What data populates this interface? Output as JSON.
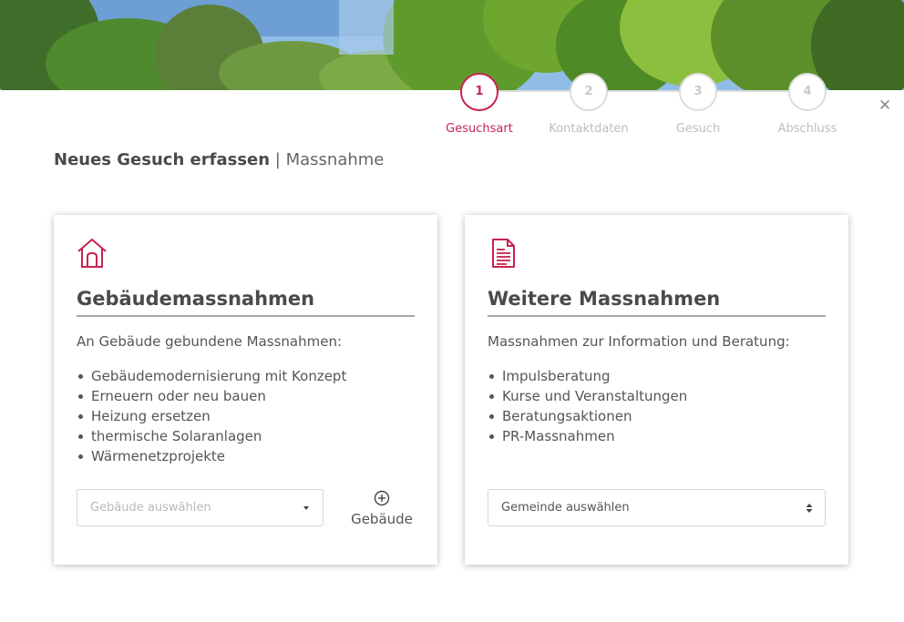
{
  "stepper": {
    "steps": [
      {
        "number": "1",
        "label": "Gesuchsart",
        "active": true
      },
      {
        "number": "2",
        "label": "Kontaktdaten",
        "active": false
      },
      {
        "number": "3",
        "label": "Gesuch",
        "active": false
      },
      {
        "number": "4",
        "label": "Abschluss",
        "active": false
      }
    ]
  },
  "close_icon": "close-icon",
  "header": {
    "title_strong": "Neues Gesuch erfassen",
    "separator": "|",
    "title_sub": "Massnahme"
  },
  "colors": {
    "accent": "#c8234f",
    "inactive": "#dcdcdc",
    "text": "#555555"
  },
  "cards": {
    "building": {
      "icon": "house-icon",
      "title": "Gebäudemassnahmen",
      "intro": "An Gebäude gebundene Massnahmen:",
      "items": [
        "Gebäudemodernisierung mit Konzept",
        "Erneuern oder neu bauen",
        "Heizung ersetzen",
        "thermische Solaranlagen",
        "Wärmenetzprojekte"
      ],
      "select_placeholder": "Gebäude auswählen",
      "add_icon": "plus-circle-icon",
      "add_label": "Gebäude"
    },
    "other": {
      "icon": "document-icon",
      "title": "Weitere Massnahmen",
      "intro": "Massnahmen zur Information und Beratung:",
      "items": [
        "Impulsberatung",
        "Kurse und Veranstaltungen",
        "Beratungsaktionen",
        "PR-Massnahmen"
      ],
      "select_value": "Gemeinde auswählen"
    }
  }
}
